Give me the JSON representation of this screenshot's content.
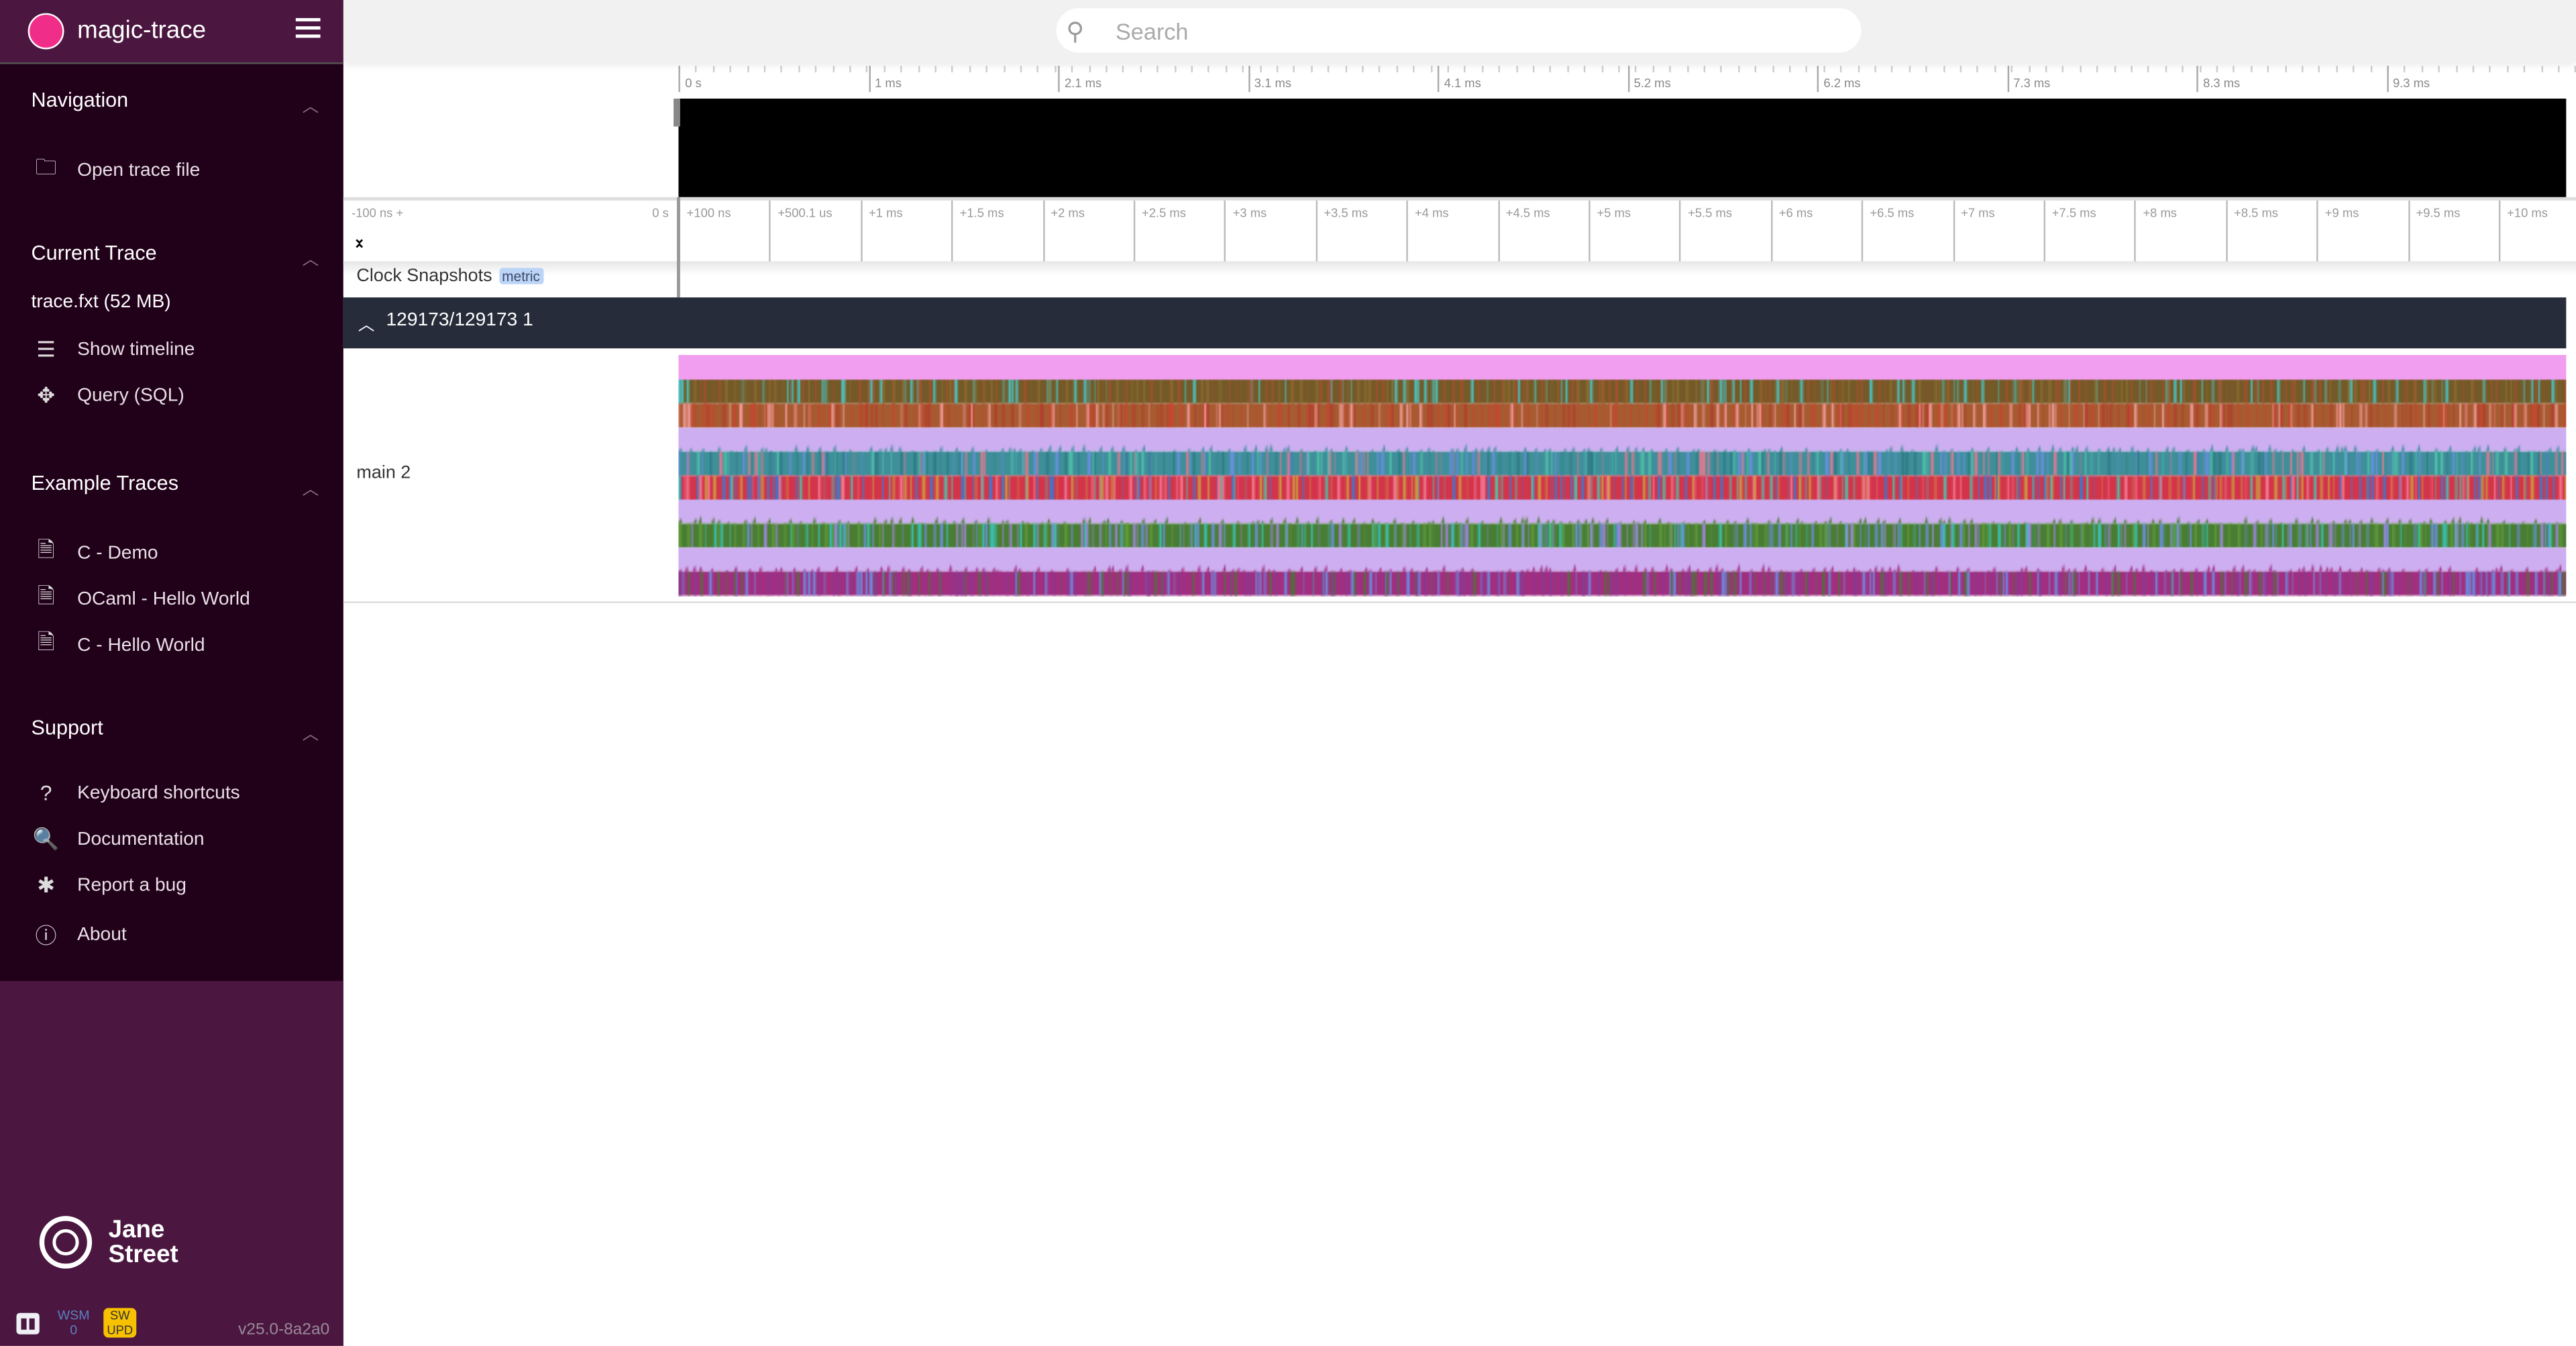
{
  "app": {
    "title": "magic-trace"
  },
  "search": {
    "placeholder": "Search",
    "value": ""
  },
  "sidebar": {
    "sections": [
      {
        "title": "Navigation",
        "items": [
          {
            "label": "Open trace file",
            "icon": "folder-icon"
          }
        ]
      },
      {
        "title": "Current Trace",
        "subtitle": "trace.fxt (52 MB)",
        "items": [
          {
            "label": "Show timeline",
            "icon": "timeline-icon"
          },
          {
            "label": "Query (SQL)",
            "icon": "query-icon"
          }
        ]
      },
      {
        "title": "Example Traces",
        "items": [
          {
            "label": "C - Demo",
            "icon": "file-icon"
          },
          {
            "label": "OCaml - Hello World",
            "icon": "file-icon"
          },
          {
            "label": "C - Hello World",
            "icon": "file-icon"
          }
        ]
      },
      {
        "title": "Support",
        "items": [
          {
            "label": "Keyboard shortcuts",
            "icon": "help-icon"
          },
          {
            "label": "Documentation",
            "icon": "docs-icon"
          },
          {
            "label": "Report a bug",
            "icon": "bug-icon"
          },
          {
            "label": "About",
            "icon": "info-icon"
          }
        ]
      }
    ],
    "footer": {
      "brand_line1": "Jane",
      "brand_line2": "Street",
      "wsm_label": "WSM",
      "wsm_count": "0",
      "sw_line1": "SW",
      "sw_line2": "UPD",
      "version": "v25.0-8a2a0"
    }
  },
  "overview_ticks": [
    "0 s",
    "1 ms",
    "2.1 ms",
    "3.1 ms",
    "4.1 ms",
    "5.2 ms",
    "6.2 ms",
    "7.3 ms",
    "8.3 ms",
    "9.3 ms"
  ],
  "axis": {
    "left": "-100 ns +",
    "zero": "0 s",
    "ticks": [
      "+100 ns",
      "+500.1 us",
      "+1 ms",
      "+1.5 ms",
      "+2 ms",
      "+2.5 ms",
      "+3 ms",
      "+3.5 ms",
      "+4 ms",
      "+4.5 ms",
      "+5 ms",
      "+5.5 ms",
      "+6 ms",
      "+6.5 ms",
      "+7 ms",
      "+7.5 ms",
      "+8 ms",
      "+8.5 ms",
      "+9 ms",
      "+9.5 ms",
      "+10 ms"
    ]
  },
  "clock": {
    "label": "Clock Snapshots",
    "badge": "metric"
  },
  "group": {
    "label": "129173/129173 1"
  },
  "track": {
    "label": "main 2",
    "bands": [
      {
        "base": "#f29ef0",
        "accents": []
      },
      {
        "base": "#735a28",
        "accents": [
          "#4cc1c0",
          "#8a6a30",
          "#a0522d"
        ]
      },
      {
        "base": "#a65b30",
        "accents": [
          "#b33f2e",
          "#f29a9a",
          "#c24a30"
        ]
      },
      {
        "base": "#cdaef0",
        "accents": []
      },
      {
        "base": "#3f8f9a",
        "accents": [
          "#4fc0a8",
          "#2e7c86",
          "#6a8fe0",
          "#e07a90"
        ]
      },
      {
        "base": "#d4344a",
        "accents": [
          "#f07890",
          "#3a7ad0",
          "#c8a040",
          "#4fc0a8"
        ]
      },
      {
        "base": "#cdaef0",
        "accents": []
      },
      {
        "base": "#4a7d34",
        "accents": [
          "#a085e0",
          "#6a8fe0",
          "#3ac0b0",
          "#5e9a3a"
        ]
      },
      {
        "base": "#cdaef0",
        "accents": []
      },
      {
        "base": "#a22e80",
        "accents": [
          "#6a8fe0",
          "#8a3a90",
          "#5a6a40"
        ]
      }
    ]
  }
}
